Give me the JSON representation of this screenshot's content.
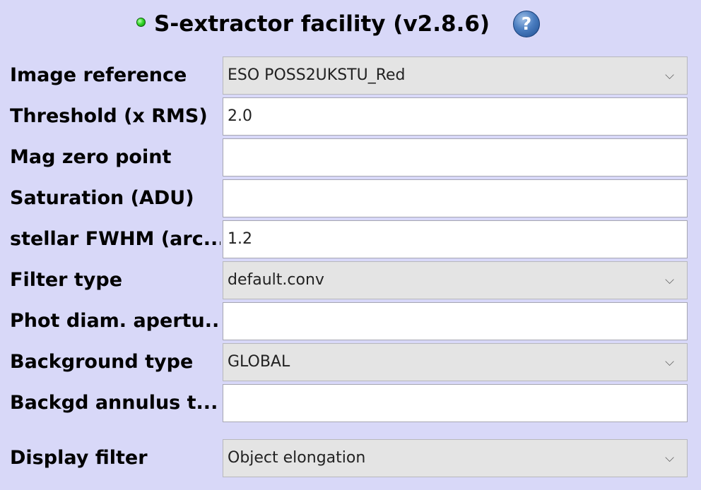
{
  "header": {
    "title": "S-extractor facility (v2.8.6)",
    "help_glyph": "?",
    "status_icon": "status-green-dot-icon",
    "help_icon": "help-question-icon"
  },
  "colors": {
    "background": "#d8d8f8",
    "status": "#35d82a",
    "help": "#3a6fb5",
    "select_bg": "#e4e4e4"
  },
  "form": {
    "rows": [
      {
        "label": "Image reference",
        "type": "select",
        "value": "ESO POSS2UKSTU_Red"
      },
      {
        "label": "Threshold (x RMS)",
        "type": "input",
        "value": "2.0"
      },
      {
        "label": "Mag zero point",
        "type": "input",
        "value": ""
      },
      {
        "label": "Saturation (ADU)",
        "type": "input",
        "value": ""
      },
      {
        "label": "stellar FWHM (arc...",
        "type": "input",
        "value": "1.2"
      },
      {
        "label": "Filter type",
        "type": "select",
        "value": "default.conv"
      },
      {
        "label": "Phot diam. apertu...",
        "type": "input",
        "value": ""
      },
      {
        "label": "Background type",
        "type": "select",
        "value": "GLOBAL"
      },
      {
        "label": "Backgd annulus t...",
        "type": "input",
        "value": ""
      },
      {
        "label": "Display filter",
        "type": "select",
        "value": "Object elongation"
      }
    ],
    "chevron_glyph": "⌵"
  }
}
